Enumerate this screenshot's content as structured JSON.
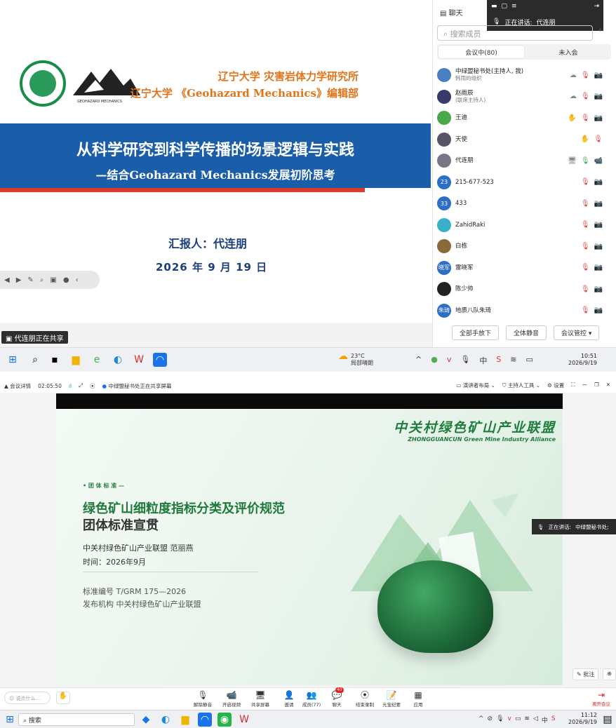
{
  "slide1": {
    "org_line1": "辽宁大学  灾害岩体力学研究所",
    "org_line2": "辽宁大学 《Geohazard Mechanics》编辑部",
    "logo_text": "GEOHAZARD  MECHANICS",
    "title": "从科学研究到科学传播的场景逻辑与实践",
    "subtitle": "—结合Geohazard Mechanics发展初阶思考",
    "reporter": "汇报人：代连朋",
    "date": "2026 年 9 月 19 日",
    "sharing_label": "代连朋正在共享"
  },
  "speaking_bar": {
    "label": "正在讲话:",
    "name": "代连朋"
  },
  "panel": {
    "tab": "聊天",
    "search_placeholder": "搜索成员",
    "seg_in": "会议中(80)",
    "seg_out": "未入会",
    "members": [
      {
        "name": "中绿盟秘书处(主持人, 我)",
        "sub": "韩雨的组织",
        "avatar": "",
        "color": "#4a7fc1",
        "icons": [
          "☁",
          "🎙",
          "📷"
        ]
      },
      {
        "name": "赵雨辰",
        "sub": "(联席主持人)",
        "avatar": "",
        "color": "#3a3a6a",
        "icons": [
          "☁",
          "🎙",
          "📷"
        ]
      },
      {
        "name": "王迪",
        "sub": "",
        "avatar": "",
        "color": "#4aa84a",
        "icons": [
          "✋",
          "🎙",
          "📷"
        ]
      },
      {
        "name": "天使",
        "sub": "",
        "avatar": "",
        "color": "#556",
        "icons": [
          "✋",
          "🎙"
        ]
      },
      {
        "name": "代连朋",
        "sub": "",
        "avatar": "",
        "color": "#778",
        "icons": [
          "🖥",
          "🎙",
          "📹"
        ]
      },
      {
        "name": "215-677-523",
        "sub": "",
        "avatar": "23",
        "color": "#2d6fc4",
        "icons": [
          "🎙",
          "📷"
        ]
      },
      {
        "name": "433",
        "sub": "",
        "avatar": "33",
        "color": "#2d6fc4",
        "icons": [
          "🎙",
          "📷"
        ]
      },
      {
        "name": "ZahidRaki",
        "sub": "",
        "avatar": "",
        "color": "#3ab0c8",
        "icons": [
          "🎙",
          "📷"
        ]
      },
      {
        "name": "白栋",
        "sub": "",
        "avatar": "",
        "color": "#8a6a3a",
        "icons": [
          "🎙",
          "📷"
        ]
      },
      {
        "name": "雷晓军",
        "sub": "",
        "avatar": "晓军",
        "color": "#2d6fc4",
        "icons": [
          "🎙",
          "📷"
        ]
      },
      {
        "name": "陈少帅",
        "sub": "",
        "avatar": "",
        "color": "#222",
        "icons": [
          "🎙",
          "📷"
        ]
      },
      {
        "name": "地质八队朱琦",
        "sub": "",
        "avatar": "朱琦",
        "color": "#2d6fc4",
        "icons": [
          "🎙",
          "📷"
        ]
      }
    ],
    "btn_raise": "全部手放下",
    "btn_mute": "全体静音",
    "btn_ctrl": "会议管控 ▾"
  },
  "taskbar1": {
    "temp": "23°C",
    "weather": "局部晴朗",
    "time": "10:51",
    "date": "2026/9/19"
  },
  "meeting_bar": {
    "details": "会议详情",
    "timer": "02:05:50",
    "sharing": "中绿盟秘书处正在共享屏幕",
    "layout": "演讲者布局",
    "host_tools": "主持人工具",
    "settings": "设置"
  },
  "slide2": {
    "brand_cn": "中关村绿色矿山产业联盟",
    "brand_en": "ZHONGGUANCUN Green Mine Industry Alliance",
    "tag": "• 团 体 标 准 —",
    "title1": "绿色矿山细粒度指标分类及评价规范",
    "title2": "团体标准宣贯",
    "presenter": "中关村绿色矿山产业联盟 范丽燕",
    "time": "时间：2026年9月",
    "std_no": "标准编号  T/GRM 175—2026",
    "publisher": "发布机构  中关村绿色矿山产业联盟"
  },
  "side_speaking": {
    "label": "正在讲话:",
    "name": "中绿盟秘书处;"
  },
  "annot": {
    "label": "批注"
  },
  "controls": {
    "say": "说点什么...",
    "items": [
      "解除静音",
      "开启视频",
      "共享屏幕",
      "邀请",
      "成员(77)",
      "聊天",
      "结束录制",
      "元宝纪要",
      "应用"
    ],
    "icons": [
      "🎙",
      "📹",
      "🖥",
      "👤",
      "👥",
      "💬",
      "⦿",
      "📝",
      "▦"
    ],
    "chat_badge": "40",
    "leave": "离开会议"
  },
  "taskbar2": {
    "search": "搜索",
    "time": "11:12",
    "date": "2026/9/19"
  }
}
